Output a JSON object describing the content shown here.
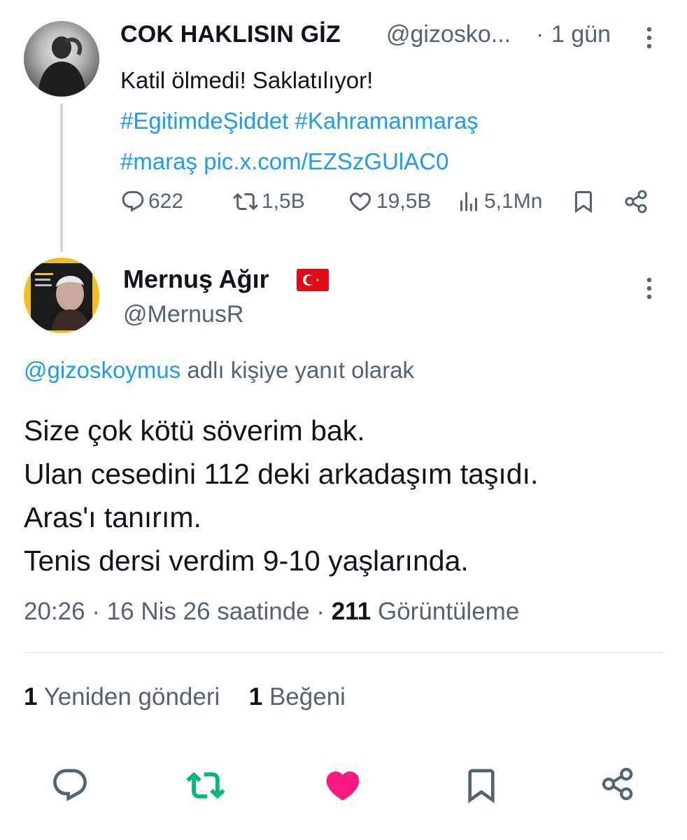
{
  "parent_tweet": {
    "display_name": "COK HAKLISIN GİZ",
    "handle": "@gizosko...",
    "separator": "·",
    "time": "1 gün",
    "text_line1": "Katil ölmedi! Saklatılıyor!",
    "hashtag1": "#EgitimdeŞiddet",
    "hashtag2": "#Kahramanmaraş",
    "hashtag3": "#maraş",
    "pic_link": "pic.x.com/EZSzGUlAC0",
    "replies": "622",
    "reposts": "1,5B",
    "likes": "19,5B",
    "views": "5,1Mn"
  },
  "reply_tweet": {
    "display_name": "Mernuş Ağır",
    "handle": "@MernusR",
    "replying_to_handle": "@gizoskoymus",
    "replying_to_suffix": "adlı kişiye yanıt olarak",
    "lines": [
      "Size çok kötü söverim bak.",
      "Ulan cesedini 112 deki arkadaşım taşıdı.",
      "Aras'ı tanırım.",
      "Tenis dersi verdim 9-10 yaşlarında."
    ],
    "time": "20:26",
    "separator": "·",
    "date": "16 Nis 26 saatinde",
    "separator2": "·",
    "view_count": "211",
    "view_label": "Görüntüleme",
    "repost_count": "1",
    "repost_label": "Yeniden gönderi",
    "like_count": "1",
    "like_label": "Beğeni"
  },
  "colors": {
    "link": "#1d9bf0",
    "secondary": "#536471",
    "repost_active": "#00ba7c",
    "like_active": "#f91880"
  },
  "icons": [
    "reply-icon",
    "repost-icon",
    "like-icon",
    "views-icon",
    "bookmark-icon",
    "share-icon",
    "more-icon",
    "turkey-flag-icon"
  ]
}
